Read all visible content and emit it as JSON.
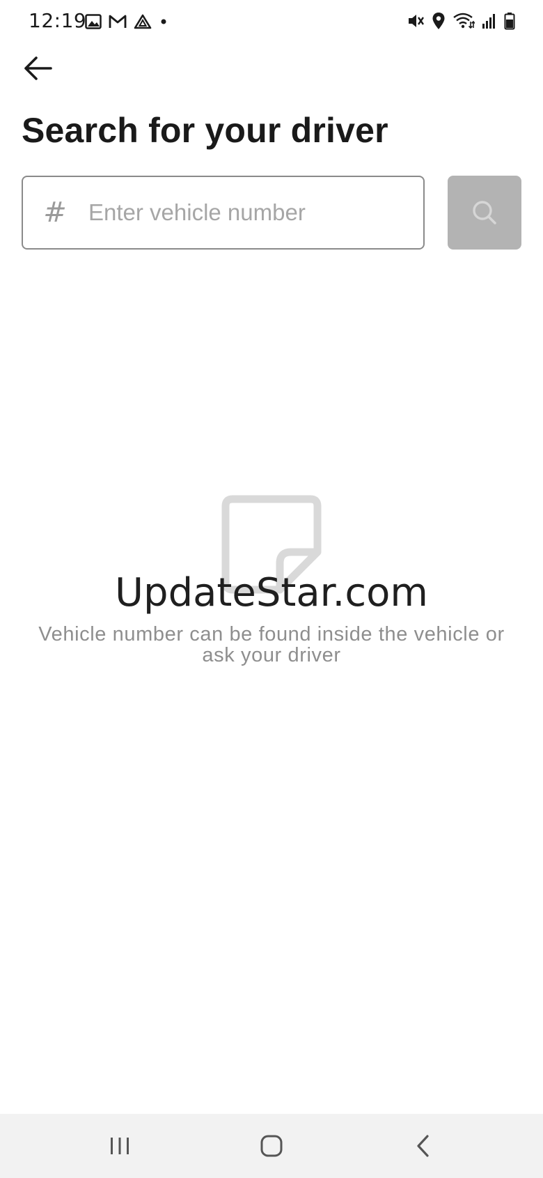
{
  "status_bar": {
    "time": "12:19",
    "left_icons": [
      "image-icon",
      "gmail-icon",
      "drive-icon",
      "notification-dot-icon"
    ],
    "right_icons": [
      "mute-vibrate-icon",
      "location-icon",
      "wifi-icon",
      "signal-icon",
      "battery-icon"
    ]
  },
  "header": {
    "back_icon": "arrow-left-icon",
    "title": "Search for your driver"
  },
  "search": {
    "prefix_symbol": "#",
    "placeholder": "Enter vehicle number",
    "value": "",
    "button_icon": "search-icon"
  },
  "empty_state": {
    "illustration_icon": "document-icon",
    "watermark": "UpdateStar.com",
    "hint": "Vehicle number can be found inside the vehicle or ask your driver"
  },
  "nav_bar": {
    "recents_icon": "recents-icon",
    "home_icon": "home-icon",
    "back_icon": "back-chevron-icon"
  },
  "colors": {
    "text_primary": "#1a1a1a",
    "text_secondary": "#8e8e8e",
    "input_border": "#8a8a8a",
    "button_disabled": "#b3b3b3",
    "nav_background": "#f2f2f2"
  }
}
